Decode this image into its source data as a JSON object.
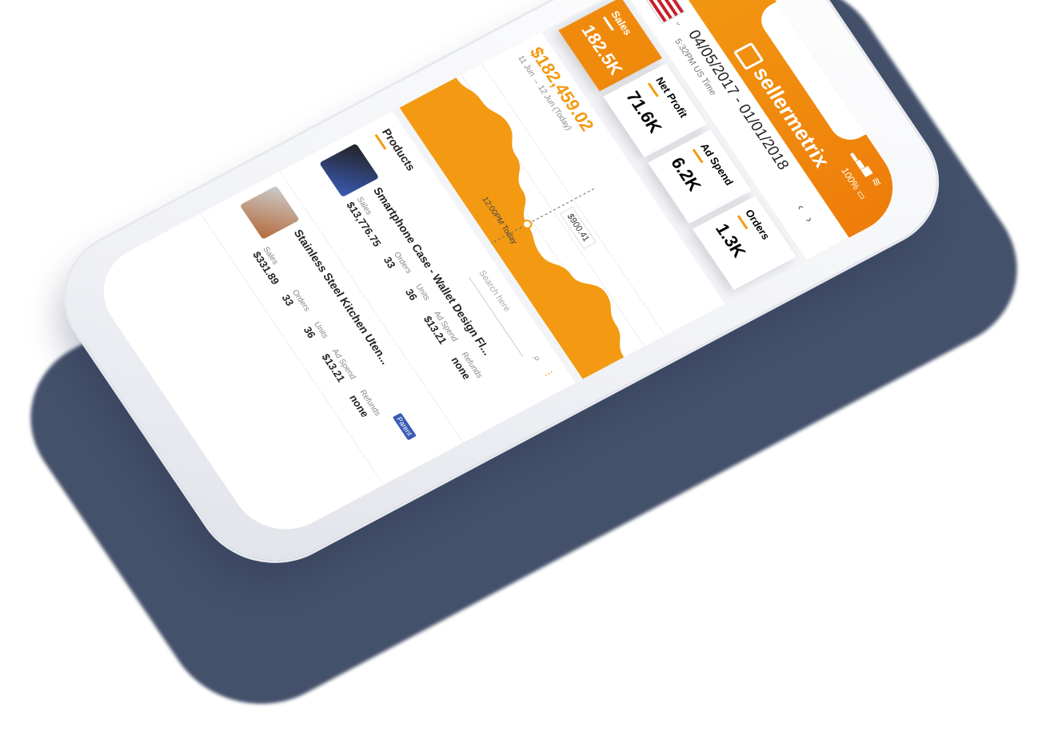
{
  "header": {
    "logo_text": "sellermetrix",
    "battery": "100%",
    "signal_icon": "signal-icon",
    "wifi_icon": "wifi-icon",
    "settings_icon": "gear-icon"
  },
  "date_row": {
    "range": "04/05/2017 - 01/01/2018",
    "time": "5:32PM US Time",
    "prev": "‹",
    "next": "›"
  },
  "cards": [
    {
      "label": "Sales",
      "value": "182.5K"
    },
    {
      "label": "Net Profit",
      "value": "71.6K"
    },
    {
      "label": "Ad Spend",
      "value": "6.2K"
    },
    {
      "label": "Orders",
      "value": "1.3K"
    }
  ],
  "chart": {
    "total": "$182,459.02",
    "period": "11 Jun → 12 Jun (Today)",
    "tooltip_value": "$900.41",
    "tooltip_time": "12:00PM Today"
  },
  "chart_data": {
    "type": "area",
    "series": [
      {
        "values": [
          0.55,
          0.62,
          0.7,
          0.6,
          0.48,
          0.35,
          0.3,
          0.42,
          0.58,
          0.5,
          0.4
        ]
      }
    ]
  },
  "products": {
    "title": "Products",
    "search_placeholder": "Search here",
    "items": [
      {
        "name": "Smartphone Case - Wallet Design Fl...",
        "sales_label": "Sales",
        "sales": "$13,776.75",
        "orders_label": "Orders",
        "orders": "33",
        "units_label": "Units",
        "units": "36",
        "adspend_label": "Ad Spend",
        "adspend": "$13.21",
        "refunds_label": "Refunds",
        "refunds": "none"
      },
      {
        "name": "Stainless Steel Kitchen Uten...",
        "badge": "Parent",
        "sales_label": "Sales",
        "sales": "$331.89",
        "orders_label": "Orders",
        "orders": "33",
        "units_label": "Units",
        "units": "36",
        "adspend_label": "Ad Spend",
        "adspend": "$13.21",
        "refunds_label": "Refunds",
        "refunds": "none"
      }
    ]
  },
  "colors": {
    "accent": "#f39a12",
    "accent_dark": "#ee7d0a",
    "shadow": "#3b4863",
    "badge": "#3b5bb5"
  }
}
